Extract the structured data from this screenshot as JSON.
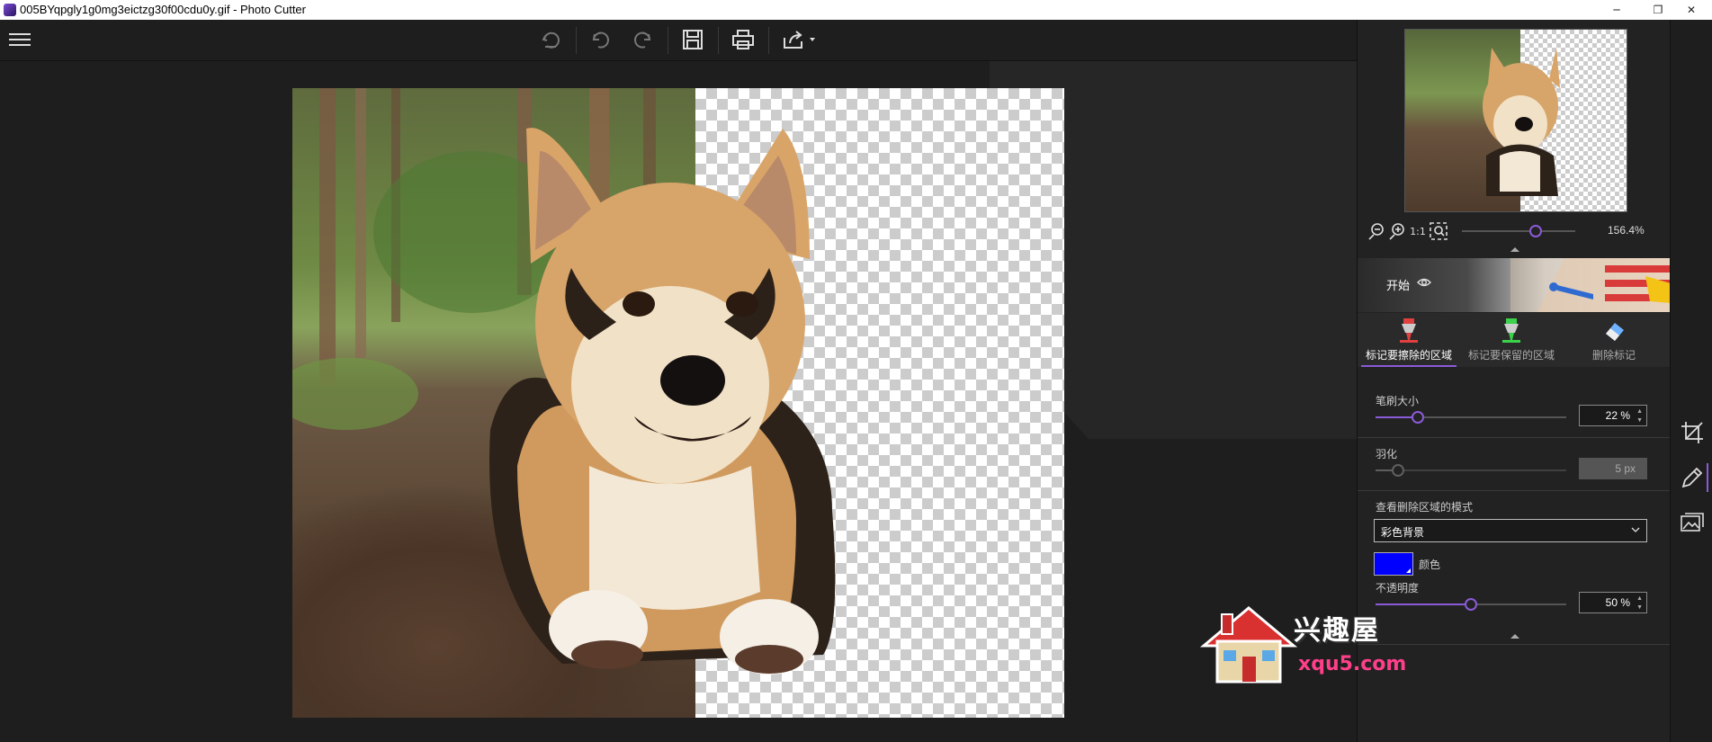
{
  "window": {
    "title": "005BYqpgly1g0mg3eictzg30f00cdu0y.gif - Photo Cutter",
    "minimize": "─",
    "maximize": "❐",
    "close": "✕"
  },
  "toolbar": {
    "menu_icon": "hamburger-menu-icon",
    "buttons": [
      "undo-all-icon",
      "undo-icon",
      "redo-icon",
      "save-icon",
      "print-icon",
      "share-icon"
    ]
  },
  "zoom": {
    "value": "156.4%",
    "fit_label": "1:1",
    "level": 0.65
  },
  "banner": {
    "label": "开始"
  },
  "tabs": [
    {
      "label": "标记要擦除的区域",
      "icon": "red-marker-icon",
      "active": true
    },
    {
      "label": "标记要保留的区域",
      "icon": "green-marker-icon",
      "active": false
    },
    {
      "label": "删除标记",
      "icon": "eraser-icon",
      "active": false
    }
  ],
  "brush": {
    "label": "笔刷大小",
    "value": "22 %",
    "level": 0.22
  },
  "feather": {
    "label": "羽化",
    "value": "5 px",
    "level": 0.12
  },
  "view_mode": {
    "label": "查看删除区域的模式",
    "selected": "彩色背景",
    "color_label": "颜色",
    "color": "#0000ff"
  },
  "opacity": {
    "label": "不透明度",
    "value": "50 %",
    "level": 0.5
  },
  "rail": [
    "crop-icon",
    "pencil-icon",
    "image-icon"
  ],
  "watermark": {
    "brand": "兴趣屋",
    "url": "xqu5.com"
  },
  "colors": {
    "accent": "#8a5bd8",
    "panel": "#222222",
    "canvas": "#1e1e1e"
  }
}
